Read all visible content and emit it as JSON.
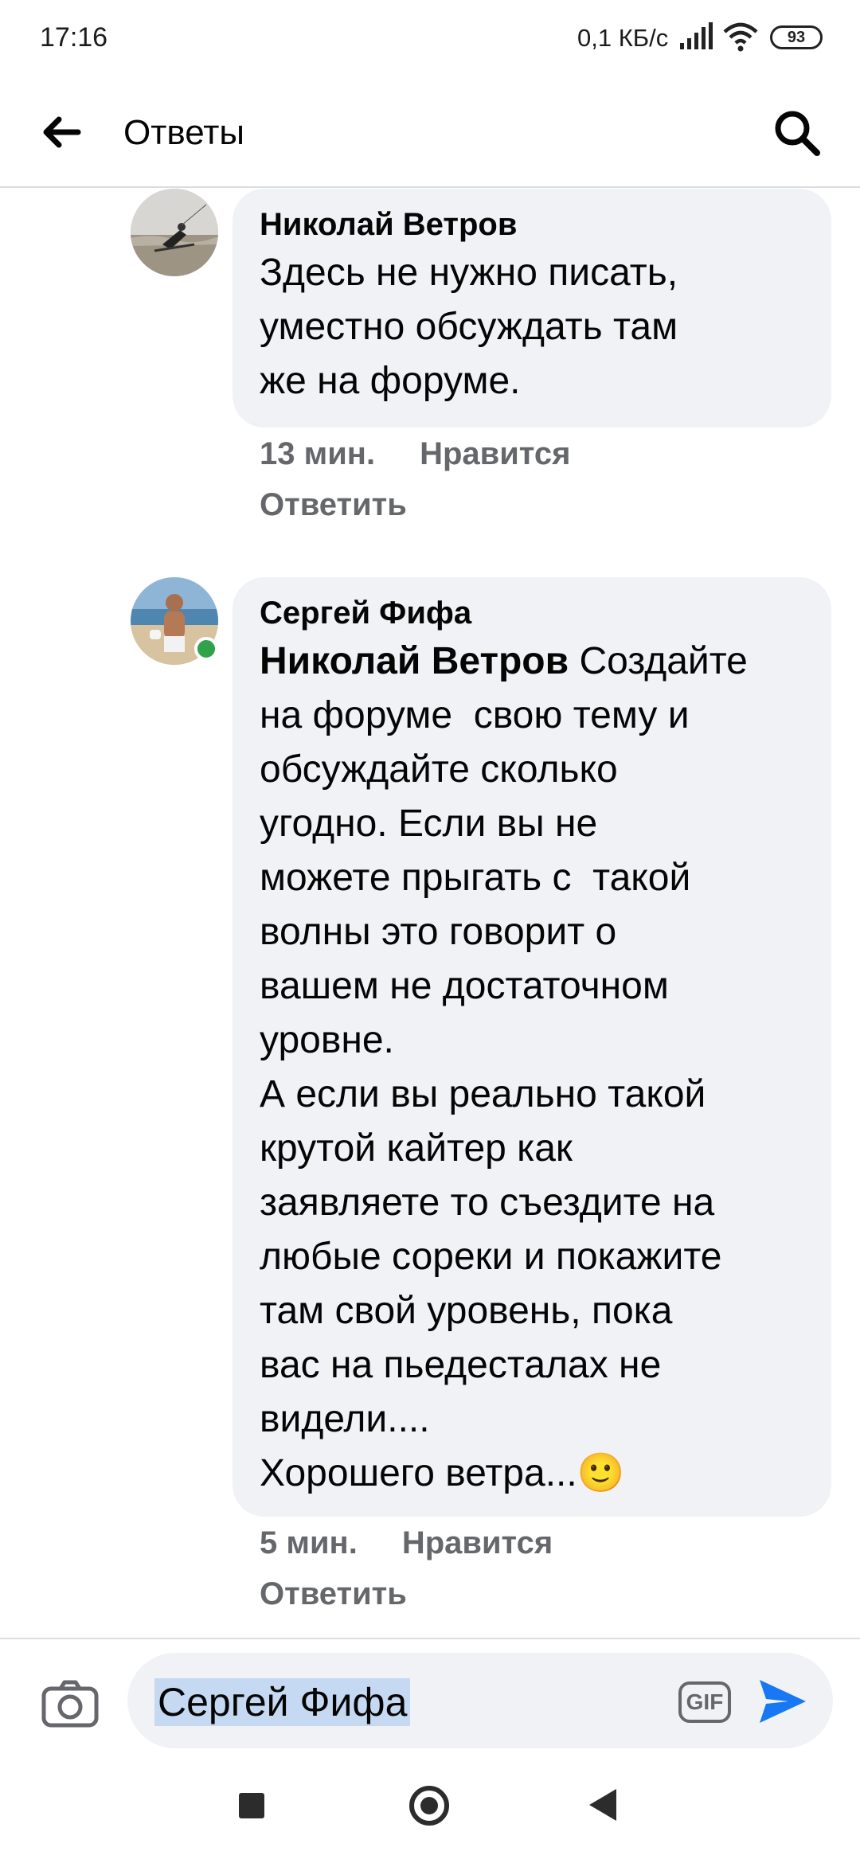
{
  "status_bar": {
    "time": "17:16",
    "network_speed": "0,1 КБ/с",
    "battery": "93"
  },
  "header": {
    "title": "Ответы",
    "back_icon": "arrow-left-icon",
    "search_icon": "search-icon"
  },
  "comments": [
    {
      "author": "Николай Ветров",
      "text": "Здесь не нужно писать,\nуместно обсуждать там\nже на форуме.",
      "time": "13 мин.",
      "like_label": "Нравится",
      "reply_label": "Ответить"
    },
    {
      "author": "Сергей Фифа",
      "mention": "Николай Ветров",
      "text": " Создайте\nна форуме  свою тему и\nобсуждайте сколько\nугодно. Если вы не\nможете прыгать с  такой\nволны это говорит о\nвашем не достаточном\nуровне.\nА если вы реально такой\nкрутой кайтер как\nзаявляете то съездите на\nлюбые сореки и покажите\nтам свой уровень, пока\nвас на пьедесталах не\nвидели....\nХорошего ветра...🙂",
      "time": "5 мин.",
      "like_label": "Нравится",
      "reply_label": "Ответить",
      "online": true
    }
  ],
  "composer": {
    "value": "Сергей Фифа",
    "camera_icon": "camera-icon",
    "gif_label": "GIF",
    "send_icon": "send-icon"
  },
  "nav": {
    "recent_icon": "square-icon",
    "home_icon": "circle-icon",
    "back_icon": "triangle-back-icon"
  },
  "colors": {
    "bubble": "#f0f2f5",
    "meta": "#65676b",
    "send": "#1877f2",
    "online": "#31a24c",
    "selection": "#c5d9f2"
  }
}
